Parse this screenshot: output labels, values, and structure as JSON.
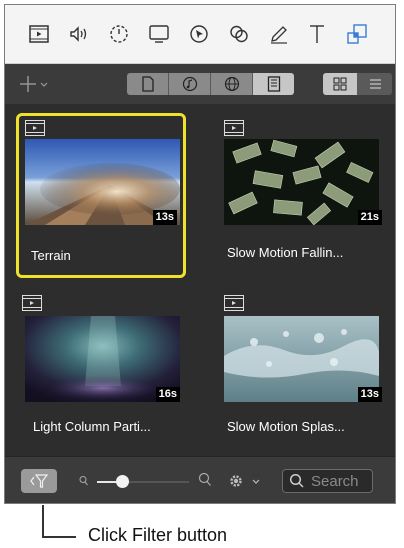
{
  "toolbar": {
    "icons": [
      "video-icon",
      "audio-icon",
      "timer-icon",
      "screen-icon",
      "cursor-icon",
      "overlay-icon",
      "pen-icon",
      "text-icon",
      "media-library-icon"
    ]
  },
  "media": {
    "items": [
      {
        "name": "Terrain",
        "duration": "13s",
        "selected": true
      },
      {
        "name": "Slow Motion Fallin...",
        "duration": "21s",
        "selected": false
      },
      {
        "name": "Light Column Parti...",
        "duration": "16s",
        "selected": false
      },
      {
        "name": "Slow Motion Splas...",
        "duration": "13s",
        "selected": false
      }
    ]
  },
  "search": {
    "placeholder": "Search"
  },
  "callout": {
    "text": "Click Filter button"
  },
  "colors": {
    "selection": "#f0e22a",
    "active_tool": "#3a7bd5"
  }
}
